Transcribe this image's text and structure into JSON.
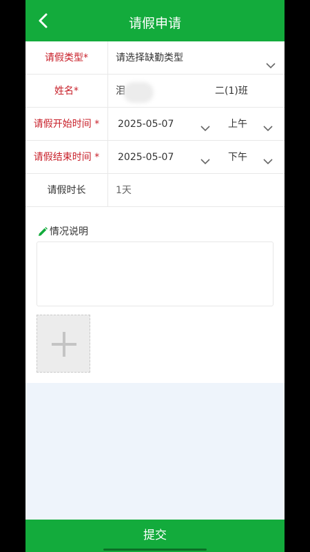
{
  "header": {
    "title": "请假申请",
    "back_icon": "chevron-left-icon"
  },
  "form": {
    "leave_type": {
      "label": "请假类型*",
      "placeholder": "请选择缺勤类型"
    },
    "name": {
      "label": "姓名*",
      "value_partial": "泪",
      "class_name": "二(1)班"
    },
    "start": {
      "label": "请假开始时间 *",
      "date": "2025-05-07",
      "period": "上午"
    },
    "end": {
      "label": "请假结束时间 *",
      "date": "2025-05-07",
      "period": "下午"
    },
    "duration": {
      "label": "请假时长",
      "value": "1天"
    },
    "remarks": {
      "label": "情况说明",
      "value": ""
    }
  },
  "submit_label": "提交",
  "colors": {
    "brand_green": "#13ab3c",
    "required_red": "#c8202a",
    "page_bg": "#eef4fb"
  }
}
